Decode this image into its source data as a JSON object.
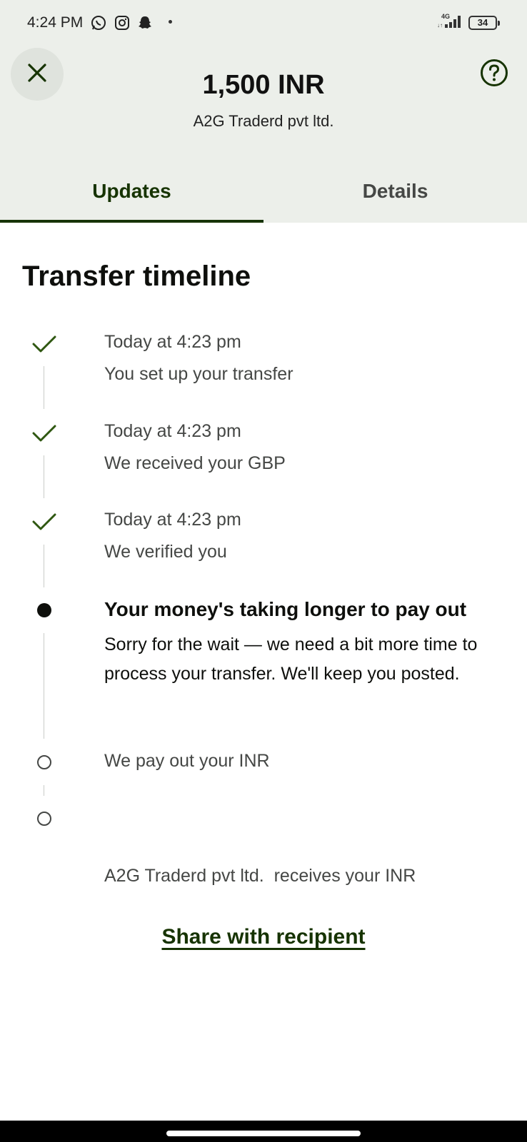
{
  "status_bar": {
    "time": "4:24 PM",
    "network": "4G",
    "battery": "34",
    "icons": [
      "whatsapp-icon",
      "instagram-icon",
      "snapchat-icon"
    ]
  },
  "header": {
    "amount": "1,500 INR",
    "recipient": "A2G Traderd pvt ltd.",
    "close_icon": "close-icon",
    "help_icon": "help-circle-icon"
  },
  "tabs": [
    {
      "label": "Updates",
      "active": true
    },
    {
      "label": "Details",
      "active": false
    }
  ],
  "timeline": {
    "title": "Transfer timeline",
    "steps": [
      {
        "status": "done",
        "time": "Today at 4:23 pm",
        "text": "You set up your transfer"
      },
      {
        "status": "done",
        "time": "Today at 4:23 pm",
        "text": "We received your GBP"
      },
      {
        "status": "done",
        "time": "Today at 4:23 pm",
        "text": "We verified you"
      },
      {
        "status": "current",
        "title": "Your money's taking longer to pay out",
        "text": "Sorry for the wait — we need a bit more time to process your transfer. We'll keep you posted."
      },
      {
        "status": "pending",
        "text": "We pay out your INR"
      },
      {
        "status": "pending",
        "text": "A2G Traderd pvt ltd.  receives your INR"
      }
    ]
  },
  "share_link": "Share with recipient",
  "colors": {
    "brand_green": "#163300",
    "check_green": "#2f5711",
    "header_bg": "#ecefea",
    "text_muted": "#454745"
  }
}
